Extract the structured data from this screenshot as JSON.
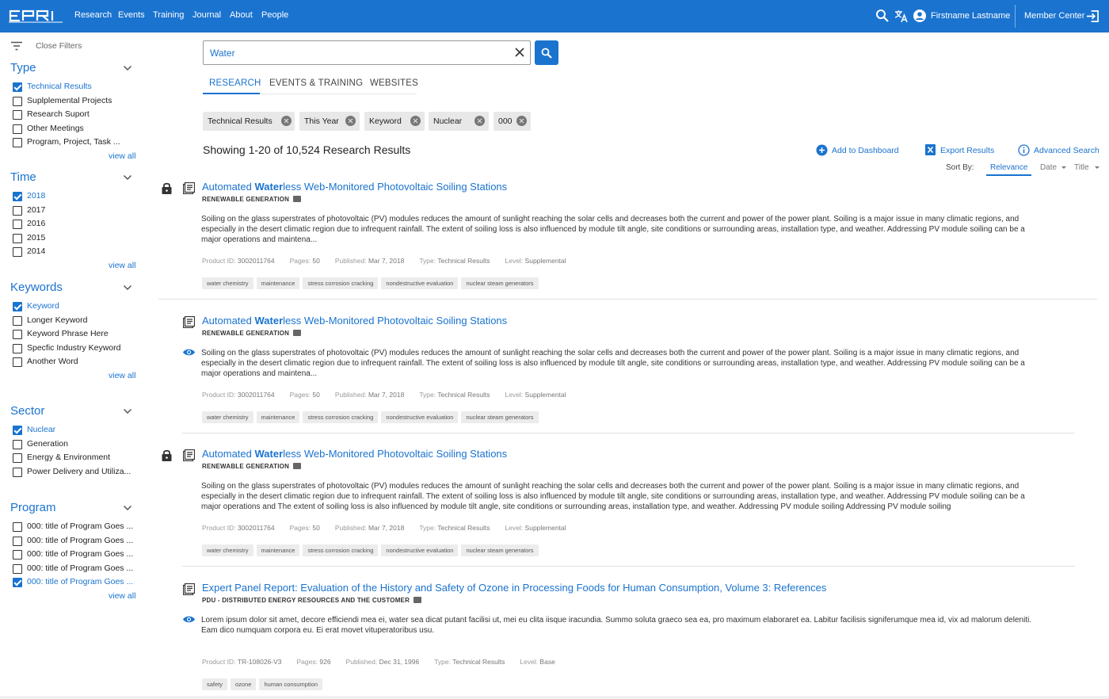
{
  "nav": {
    "logo": "EPRI",
    "items": [
      "Research",
      "Events",
      "Training",
      "Journal",
      "About",
      "People"
    ],
    "user_name": "Firstname Lastname",
    "member_center": "Member Center"
  },
  "sidebar": {
    "close_filters": "Close Filters",
    "view_all": "view all",
    "sections": [
      {
        "title": "Type",
        "items": [
          {
            "label": "Technical Results",
            "checked": true
          },
          {
            "label": "Suplplemental Projects",
            "checked": false
          },
          {
            "label": "Research Suport",
            "checked": false
          },
          {
            "label": "Other Meetings",
            "checked": false
          },
          {
            "label": "Program, Project, Task ...",
            "checked": false
          }
        ]
      },
      {
        "title": "Time",
        "items": [
          {
            "label": "2018",
            "checked": true
          },
          {
            "label": "2017",
            "checked": false
          },
          {
            "label": "2016",
            "checked": false
          },
          {
            "label": "2015",
            "checked": false
          },
          {
            "label": "2014",
            "checked": false
          }
        ]
      },
      {
        "title": "Keywords",
        "items": [
          {
            "label": "Keyword",
            "checked": true
          },
          {
            "label": "Longer Keyword",
            "checked": false
          },
          {
            "label": "Keyword Phrase Here",
            "checked": false
          },
          {
            "label": "Specfic Industry Keyword",
            "checked": false
          },
          {
            "label": "Another Word",
            "checked": false
          }
        ]
      },
      {
        "title": "Sector",
        "items": [
          {
            "label": "Nuclear",
            "checked": true
          },
          {
            "label": "Generation",
            "checked": false
          },
          {
            "label": "Energy & Environment",
            "checked": false
          },
          {
            "label": "Power Delivery and Utiliza...",
            "checked": false
          }
        ]
      },
      {
        "title": "Program",
        "items": [
          {
            "label": "000: title of Program Goes ...",
            "checked": false
          },
          {
            "label": "000: title of Program Goes ...",
            "checked": false
          },
          {
            "label": "000: title of Program Goes ...",
            "checked": false
          },
          {
            "label": "000: title of Program Goes ...",
            "checked": false
          },
          {
            "label": "000: title of Program Goes ...",
            "checked": true
          }
        ]
      }
    ]
  },
  "search": {
    "value": "Water",
    "tabs": [
      "RESEARCH",
      "EVENTS & TRAINING",
      "WEBSITES"
    ],
    "active_tab": "RESEARCH",
    "chips": [
      "Technical Results",
      "This Year",
      "Keyword",
      "Nuclear",
      "000"
    ]
  },
  "results_header": {
    "count_text": "Showing 1-20 of 10,524 Research Results",
    "add_to_dashboard": "Add to Dashboard",
    "export_results": "Export Results",
    "advanced_search": "Advanced Search",
    "sort_by": "Sort By:",
    "sort_options": [
      "Relevance",
      "Date",
      "Title"
    ],
    "active_sort": "Relevance"
  },
  "results": [
    {
      "title_pre": "Automated ",
      "title_bold": "Water",
      "title_post": "less Web-Monitored Photovoltaic Soiling Stations",
      "subtitle": "RENEWABLE GENERATION",
      "locked": true,
      "preview": false,
      "description": "Soiling on the glass superstrates of photovoltaic (PV) modules reduces the amount of sunlight reaching the solar cells and decreases both the current and power of the power plant. Soiling is a major issue in many climatic regions, and especially in the desert climatic region due to infrequent rainfall. The extent of soiling loss is also influenced by module tilt angle, site conditions or surrounding areas, installation type, and weather. Addressing PV module soiling can be a major operations and maintena...",
      "product_id": "3002011764",
      "pages": "50",
      "published": "Mar 7, 2018",
      "type": "Technical Results",
      "level": "Supplemental",
      "tags": [
        "water chemistry",
        "maintenance",
        "stress corrosion cracking",
        "nondestructive evaluation",
        "nuclear steam generators"
      ]
    },
    {
      "title_pre": "Automated ",
      "title_bold": "Water",
      "title_post": "less Web-Monitored Photovoltaic Soiling Stations",
      "subtitle": "RENEWABLE GENERATION",
      "locked": false,
      "preview": true,
      "description": "Soiling on the glass superstrates of photovoltaic (PV) modules reduces the amount of sunlight reaching the solar cells and decreases both the current and power of the power plant. Soiling is a major issue in many climatic regions, and especially in the desert climatic region due to infrequent rainfall. The extent of soiling loss is also influenced by module tilt angle, site conditions or surrounding areas, installation type, and weather. Addressing PV module soiling can be a major operations and maintena...",
      "product_id": "3002011764",
      "pages": "50",
      "published": "Mar 7, 2018",
      "type": "Technical Results",
      "level": "Supplemental",
      "tags": [
        "water chemistry",
        "maintenance",
        "stress corrosion cracking",
        "nondestructive evaluation",
        "nuclear steam generators"
      ]
    },
    {
      "title_pre": "Automated ",
      "title_bold": "Water",
      "title_post": "less Web-Monitored Photovoltaic Soiling Stations",
      "subtitle": "RENEWABLE GENERATION",
      "locked": true,
      "preview": false,
      "description": "Soiling on the glass superstrates of photovoltaic (PV) modules reduces the amount of sunlight reaching the solar cells and decreases both the current and power of the power plant. Soiling is a major issue in many climatic regions, and especially in the desert climatic region due to infrequent rainfall. The extent of soiling loss is also influenced by module tilt angle, site conditions or surrounding areas, installation type, and weather. Addressing PV module soiling can be a major operations and The extent of soiling loss is also influenced by module tilt angle, site conditions or surrounding areas, installation type, and weather. Addressing PV module soiling  Addressing PV module soiling",
      "product_id": "3002011764",
      "pages": "50",
      "published": "Mar 7, 2018",
      "type": "Technical Results",
      "level": "Supplemental",
      "tags": [
        "water chemistry",
        "maintenance",
        "stress corrosion cracking",
        "nondestructive evaluation",
        "nuclear steam generators"
      ]
    },
    {
      "title_pre": "Expert Panel Report: Evaluation of the History and Safety of Ozone in Processing Foods for Human Consumption, Volume 3: References",
      "title_bold": "",
      "title_post": "",
      "subtitle": "PDU - DISTRIBUTED ENERGY RESOURCES AND THE CUSTOMER",
      "locked": false,
      "preview": true,
      "description": "Lorem ipsum dolor sit amet, decore efficiendi mea ei, water sea dicat putant facilisi ut, mei eu clita iisque iracundia. Summo soluta graeco sea ea, pro maximum elaboraret ea. Labitur facilisis signiferumque mea id, vix ad malorum deleniti. Eam dico numquam corpora eu. Ei erat movet vituperatoribus usu.",
      "product_id": "TR-108026-V3",
      "pages": "926",
      "published": "Dec 31, 1996",
      "type": "Technical Results",
      "level": "Base",
      "tags": [
        "safety",
        "ozone",
        "human consumption"
      ]
    }
  ],
  "meta_labels": {
    "product_id": "Product ID:",
    "pages": "Pages:",
    "published": "Published:",
    "type": "Type:",
    "level": "Level:"
  },
  "colors": {
    "brand": "#1a73cf"
  }
}
